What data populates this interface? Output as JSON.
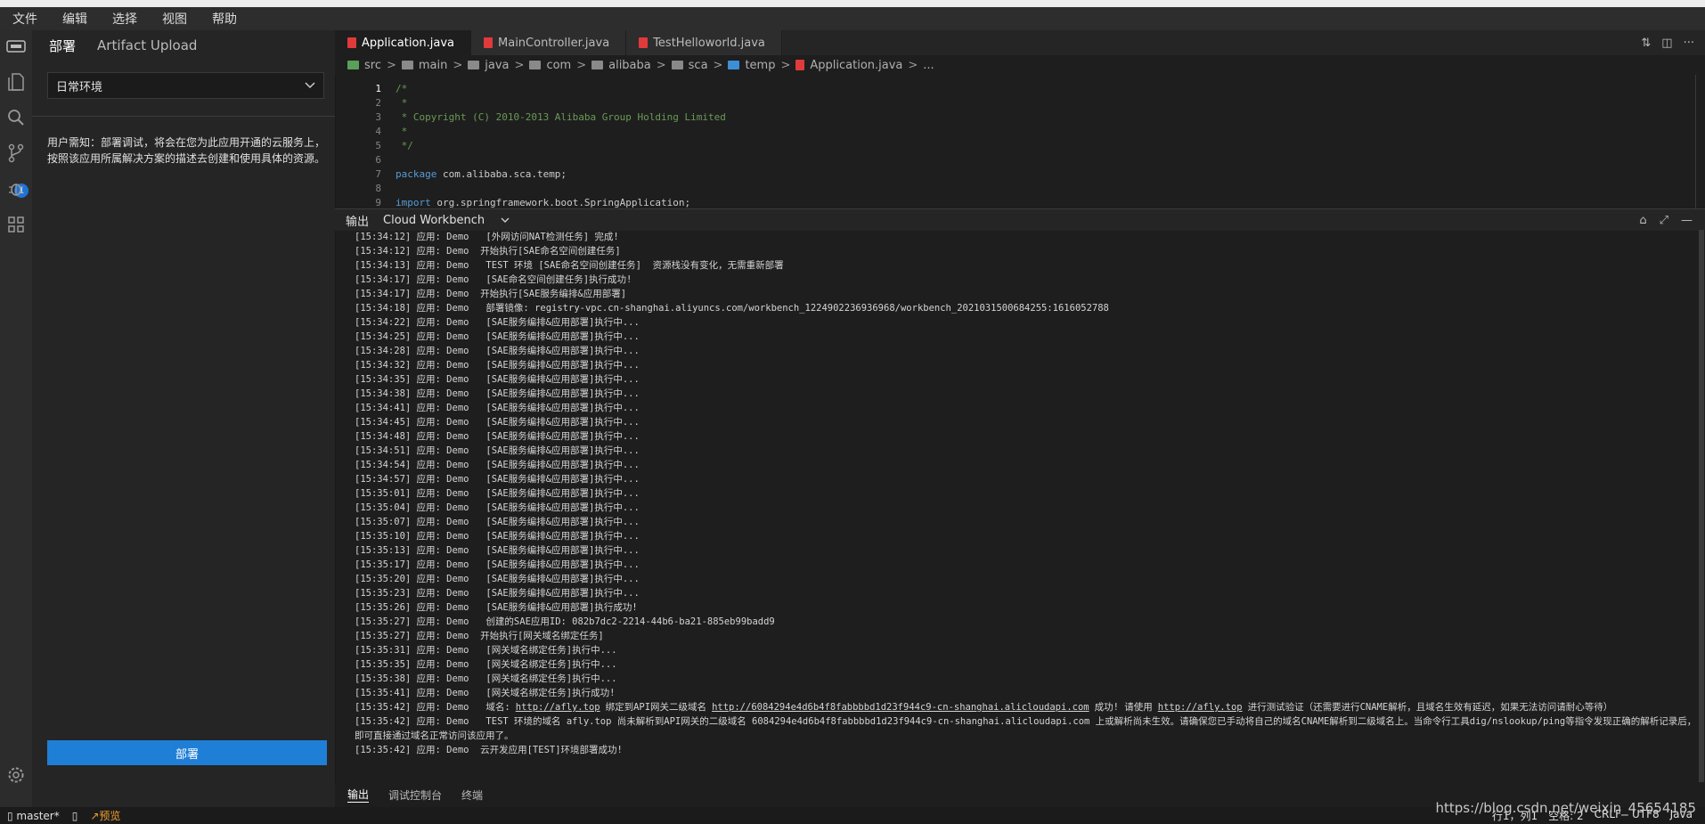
{
  "menubar": {
    "items": [
      "文件",
      "编辑",
      "选择",
      "视图",
      "帮助"
    ]
  },
  "activitybar": {
    "scm_badge": "1"
  },
  "sidebar": {
    "tabs": [
      "部署",
      "Artifact Upload"
    ],
    "env_select": "日常环境",
    "notice": "用户需知：部署调试，将会在您为此应用开通的云服务上，按照该应用所属解决方案的描述去创建和使用具体的资源。",
    "deploy_button": "部署"
  },
  "editor": {
    "tabs": [
      "Application.java",
      "MainController.java",
      "TestHelloworld.java"
    ],
    "breadcrumb": [
      "src",
      "main",
      "java",
      "com",
      "alibaba",
      "sca",
      "temp",
      "Application.java",
      "..."
    ],
    "code_lines": [
      {
        "n": "1",
        "t": "/*"
      },
      {
        "n": "2",
        "t": " *"
      },
      {
        "n": "3",
        "t": " * Copyright (C) 2010-2013 Alibaba Group Holding Limited"
      },
      {
        "n": "4",
        "t": " *"
      },
      {
        "n": "5",
        "t": " */"
      },
      {
        "n": "6",
        "t": ""
      },
      {
        "n": "7",
        "t": "package com.alibaba.sca.temp;"
      },
      {
        "n": "8",
        "t": ""
      },
      {
        "n": "9",
        "t": "import org.springframework.boot.SpringApplication;"
      }
    ]
  },
  "panel": {
    "title": "输出",
    "channel": "Cloud Workbench",
    "log_lines": [
      "[15:34:12] 应用: Demo   [外网访问NAT检测任务] 完成!",
      "[15:34:12] 应用: Demo  开始执行[SAE命名空间创建任务]",
      "[15:34:13] 应用: Demo   TEST 环境 [SAE命名空间创建任务]  资源栈没有变化，无需重新部署",
      "[15:34:17] 应用: Demo   [SAE命名空间创建任务]执行成功!",
      "[15:34:17] 应用: Demo  开始执行[SAE服务编排&应用部署]",
      "[15:34:18] 应用: Demo   部署镜像: registry-vpc.cn-shanghai.aliyuncs.com/workbench_1224902236936968/workbench_2021031500684255:1616052788",
      "[15:34:22] 应用: Demo   [SAE服务编排&应用部署]执行中...",
      "[15:34:25] 应用: Demo   [SAE服务编排&应用部署]执行中...",
      "[15:34:28] 应用: Demo   [SAE服务编排&应用部署]执行中...",
      "[15:34:32] 应用: Demo   [SAE服务编排&应用部署]执行中...",
      "[15:34:35] 应用: Demo   [SAE服务编排&应用部署]执行中...",
      "[15:34:38] 应用: Demo   [SAE服务编排&应用部署]执行中...",
      "[15:34:41] 应用: Demo   [SAE服务编排&应用部署]执行中...",
      "[15:34:45] 应用: Demo   [SAE服务编排&应用部署]执行中...",
      "[15:34:48] 应用: Demo   [SAE服务编排&应用部署]执行中...",
      "[15:34:51] 应用: Demo   [SAE服务编排&应用部署]执行中...",
      "[15:34:54] 应用: Demo   [SAE服务编排&应用部署]执行中...",
      "[15:34:57] 应用: Demo   [SAE服务编排&应用部署]执行中...",
      "[15:35:01] 应用: Demo   [SAE服务编排&应用部署]执行中...",
      "[15:35:04] 应用: Demo   [SAE服务编排&应用部署]执行中...",
      "[15:35:07] 应用: Demo   [SAE服务编排&应用部署]执行中...",
      "[15:35:10] 应用: Demo   [SAE服务编排&应用部署]执行中...",
      "[15:35:13] 应用: Demo   [SAE服务编排&应用部署]执行中...",
      "[15:35:17] 应用: Demo   [SAE服务编排&应用部署]执行中...",
      "[15:35:20] 应用: Demo   [SAE服务编排&应用部署]执行中...",
      "[15:35:23] 应用: Demo   [SAE服务编排&应用部署]执行中...",
      "[15:35:26] 应用: Demo   [SAE服务编排&应用部署]执行成功!",
      "[15:35:27] 应用: Demo   创建的SAE应用ID: 082b7dc2-2214-44b6-ba21-885eb99badd9",
      "[15:35:27] 应用: Demo  开始执行[网关域名绑定任务]",
      "[15:35:31] 应用: Demo   [网关域名绑定任务]执行中...",
      "[15:35:35] 应用: Demo   [网关域名绑定任务]执行中...",
      "[15:35:38] 应用: Demo   [网关域名绑定任务]执行中...",
      "[15:35:41] 应用: Demo   [网关域名绑定任务]执行成功!"
    ],
    "domain_line": {
      "prefix": "[15:35:42] 应用: Demo   域名:",
      "link1": "http://afly.top",
      "mid1": "绑定到API网关二级域名",
      "link2": "http://6084294e4d6b4f8fabbbbd1d23f944c9-cn-shanghai.alicloudapi.com",
      "mid2": "成功! 请使用",
      "link3": "http://afly.top",
      "suffix": "进行测试验证（还需要进行CNAME解析，且域名生效有延迟，如果无法访问请耐心等待）"
    },
    "tail_lines": [
      "[15:35:42] 应用: Demo   TEST 环境的域名 afly.top 尚未解析到API网关的二级域名 6084294e4d6b4f8fabbbbd1d23f944c9-cn-shanghai.alicloudapi.com 上或解析尚未生效。请确保您已手动将自己的域名CNAME解析到二级域名上。当命令行工具dig/nslookup/ping等指令发现正确的解析记录后，即可直接通过域名正常访问该应用了。",
      "[15:35:42] 应用: Demo  云开发应用[TEST]环境部署成功!"
    ],
    "bottom_tabs": [
      "输出",
      "调试控制台",
      "终端"
    ]
  },
  "statusbar": {
    "branch": "master*",
    "preview": "预览",
    "right": [
      "行1，列1",
      "空格: 2",
      "CRLF",
      "UTF8",
      "Java"
    ]
  },
  "watermark": "https://blog.csdn.net/weixin_45654185"
}
